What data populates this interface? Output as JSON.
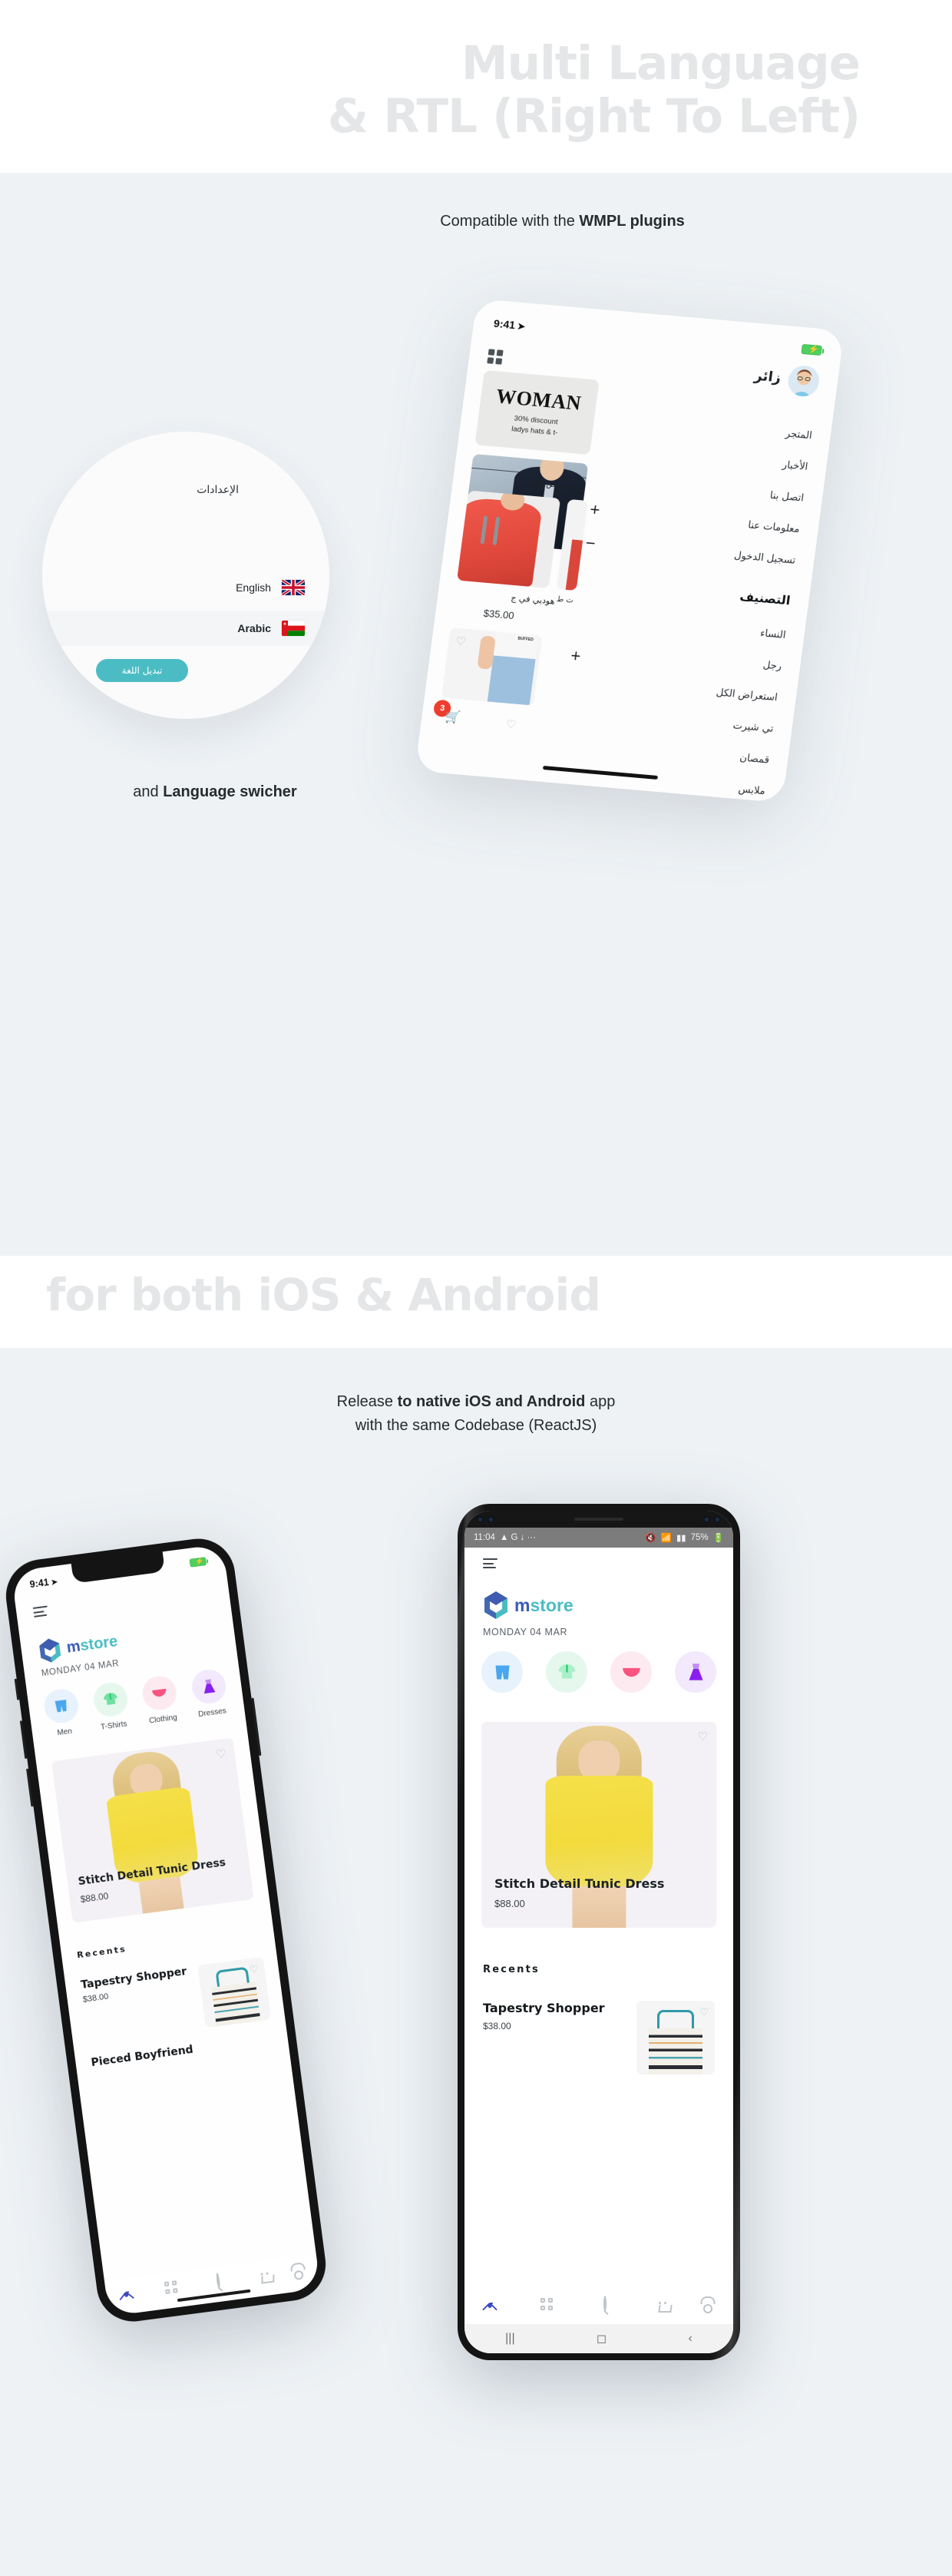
{
  "section1": {
    "title_line1": "Multi Language",
    "title_line2": "& RTL (Right To Left)",
    "caption_prefix": "Compatible with the ",
    "caption_bold": "WMPL plugins",
    "sub_prefix": "and ",
    "sub_bold": "Language swicher",
    "language_card": {
      "title": "الإعدادات",
      "options": [
        {
          "label": "English",
          "flag": "uk-flag",
          "selected": false
        },
        {
          "label": "Arabic",
          "flag": "oman-flag",
          "selected": true
        }
      ],
      "button_label": "تبديل اللغة",
      "button_color": "#4cbcc4"
    },
    "arabic_phone": {
      "status_time": "9:41",
      "status_location_icon": "location-arrow-icon",
      "battery_label": "charging-battery-icon",
      "user_name": "زائر",
      "avatar": "user-avatar",
      "grid_icon": "grid-icon",
      "menu": [
        {
          "label": "المتجر",
          "header": false
        },
        {
          "label": "الأخبار",
          "header": false
        },
        {
          "label": "اتصل بنا",
          "header": false
        },
        {
          "label": "معلومات عنا",
          "header": false
        },
        {
          "label": "تسجيل الدخول",
          "header": false
        },
        {
          "label": "التصنيف",
          "header": true
        },
        {
          "label": "النساء",
          "header": false
        },
        {
          "label": "رجل",
          "header": false
        },
        {
          "label": "استعراض الكل",
          "header": false
        },
        {
          "label": "تي شيرت",
          "header": false
        },
        {
          "label": "قمصان",
          "header": false
        },
        {
          "label": "ملابس",
          "header": false
        }
      ],
      "promo": {
        "headline": "WOMAN",
        "line1": "30% discount",
        "line2": "ladys hats & t-"
      },
      "browse_all": "استعراض الكل",
      "browse_all_chevron": "chevron-left-icon",
      "product": {
        "title": "هوديي في ج",
        "price": "$35.00"
      },
      "fragment_text": "ت ط",
      "stepper_plus": "+",
      "stepper_minus": "−",
      "cart_badge": "3"
    }
  },
  "section2": {
    "title_line1": "for both iOS & Android",
    "caption_line1_prefix": "Release ",
    "caption_line1_bold": "to native iOS and Android",
    "caption_line1_suffix": " app",
    "caption_line2": "with the same Codebase (ReactJS)",
    "app": {
      "brand_m": "m",
      "brand_rest": "store",
      "date": "MONDAY 04 MAR",
      "hamburger_icon": "hamburger-menu-icon",
      "categories": [
        {
          "label": "Men",
          "icon": "shorts-icon",
          "bubble": "#e8f2fd",
          "color": "#49a7ee"
        },
        {
          "label": "T-Shirts",
          "icon": "tshirt-icon",
          "bubble": "#e6f8ee",
          "color": "#6fe0a0"
        },
        {
          "label": "Clothing",
          "icon": "panties-icon",
          "bubble": "#fdeaf0",
          "color": "#f9547f"
        },
        {
          "label": "Dresses",
          "icon": "dress-icon",
          "bubble": "#f2e9fd",
          "color": "#8a1ff0"
        }
      ],
      "hero": {
        "name": "Stitch Detail Tunic Dress",
        "price": "$88.00"
      },
      "recents_label": "Recents",
      "recents": [
        {
          "name": "Tapestry Shopper",
          "price": "$38.00"
        },
        {
          "name": "Pieced Boyfriend",
          "price": ""
        }
      ],
      "nav": [
        {
          "icon": "home-icon",
          "active": true
        },
        {
          "icon": "grid-icon",
          "active": false
        },
        {
          "icon": "search-icon",
          "active": false
        },
        {
          "icon": "cart-icon",
          "active": false
        },
        {
          "icon": "profile-icon",
          "active": false
        }
      ]
    },
    "iphone": {
      "status_time": "9:41",
      "status_location_icon": "location-arrow-icon",
      "battery_label": "charging-battery-icon"
    },
    "android": {
      "status_time": "11:04",
      "status_icons": "▲ G ↓ ···",
      "status_right_icons": "mute-icon wifi-icon signal-icon",
      "battery_percent": "75%",
      "sys_recent": "|||",
      "sys_home": "◻",
      "sys_back": "‹"
    }
  }
}
